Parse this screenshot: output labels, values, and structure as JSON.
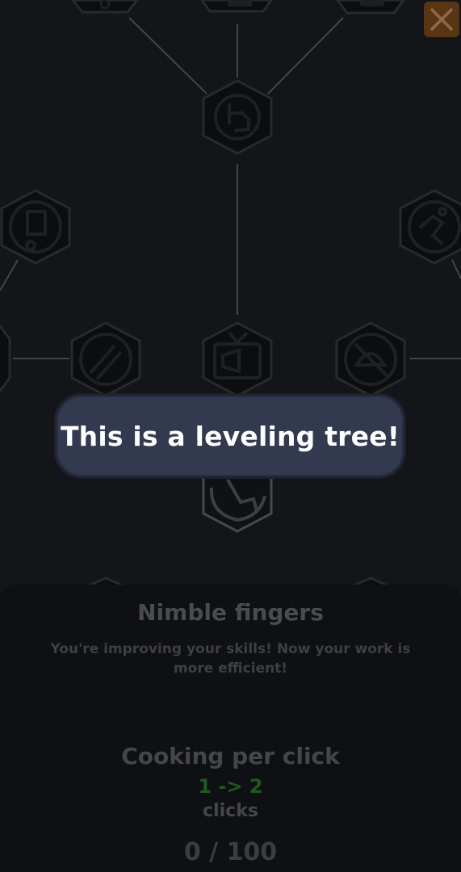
{
  "tooltip": {
    "text": "This is a leveling tree!"
  },
  "close_button": {
    "icon": "close-icon"
  },
  "skill": {
    "title": "Nimble fingers",
    "description": "You're improving your skills! Now your work is more efficient!",
    "stat_label": "Cooking per click",
    "stat_change": "1 -> 2",
    "stat_unit": "clicks",
    "progress": "0 / 100"
  },
  "tree_nodes": [
    {
      "icon": "wrench-icon",
      "state": "locked"
    },
    {
      "icon": "monitor-icon",
      "state": "locked"
    },
    {
      "icon": "vehicle-icon",
      "state": "locked"
    },
    {
      "icon": "tap-hand-icon",
      "state": "locked"
    },
    {
      "icon": "hand-truck-icon",
      "state": "locked"
    },
    {
      "icon": "running-man-icon",
      "state": "locked"
    },
    {
      "icon": "tools-icon",
      "state": "locked"
    },
    {
      "icon": "tv-megaphone-icon",
      "state": "locked"
    },
    {
      "icon": "no-helmet-icon",
      "state": "locked"
    },
    {
      "icon": "pointing-hand-icon",
      "state": "current"
    }
  ],
  "colors": {
    "background": "#17181c",
    "close_button": "#5a3514",
    "tooltip_bg": "#333a4f",
    "progress_green": "#1d5a1f"
  }
}
